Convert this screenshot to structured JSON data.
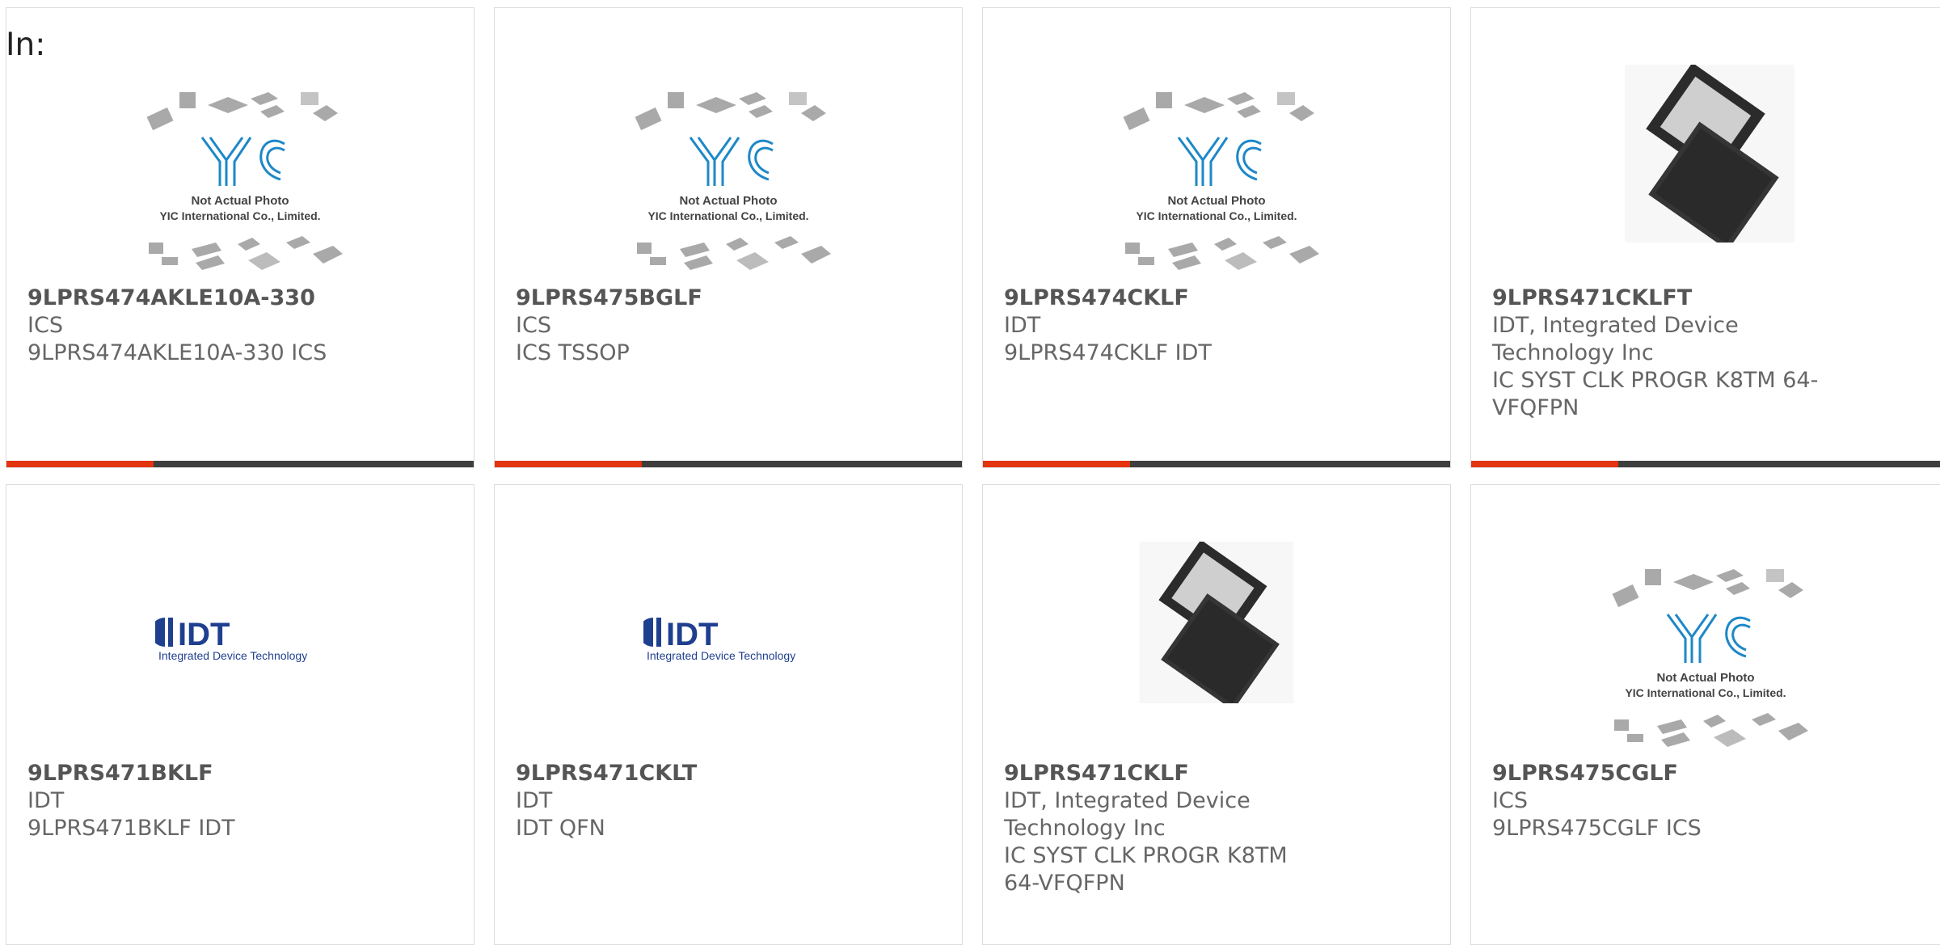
{
  "header": {
    "in_label": "In:"
  },
  "placeholder_text": {
    "logo": "YIC",
    "line1": "Not Actual Photo",
    "line2": "YIC International Co., Limited."
  },
  "idt_logo": {
    "mark": "IDT",
    "tagline": "Integrated Device Technology"
  },
  "colors": {
    "accent": "#e3330f",
    "bar": "#3e3e3e",
    "yic_blue": "#1e88c8",
    "idt_blue": "#1f3f8f"
  },
  "products": [
    {
      "part": "9LPRS474AKLE10A-330",
      "maker": "ICS",
      "desc": "9LPRS474AKLE10A-330 ICS",
      "image": "yic-placeholder"
    },
    {
      "part": "9LPRS475BGLF",
      "maker": "ICS",
      "desc": "ICS TSSOP",
      "image": "yic-placeholder"
    },
    {
      "part": "9LPRS474CKLF",
      "maker": "IDT",
      "desc": "9LPRS474CKLF IDT",
      "image": "yic-placeholder"
    },
    {
      "part": "9LPRS471CKLFT",
      "maker": "IDT, Integrated Device Technology Inc",
      "desc": "IC SYST CLK PROGR K8TM 64-VFQFPN",
      "image": "qfn-chip-photo"
    },
    {
      "part": "9LPRS471BKLF",
      "maker": "IDT",
      "desc": "9LPRS471BKLF IDT",
      "image": "idt-logo"
    },
    {
      "part": "9LPRS471CKLT",
      "maker": "IDT",
      "desc": "IDT QFN",
      "image": "idt-logo"
    },
    {
      "part": "9LPRS471CKLF",
      "maker": "IDT, Integrated Device Technology Inc",
      "desc": "IC SYST CLK PROGR K8TM 64-VFQFPN",
      "image": "qfn-chip-photo"
    },
    {
      "part": "9LPRS475CGLF",
      "maker": "ICS",
      "desc": "9LPRS475CGLF ICS",
      "image": "yic-placeholder"
    }
  ]
}
